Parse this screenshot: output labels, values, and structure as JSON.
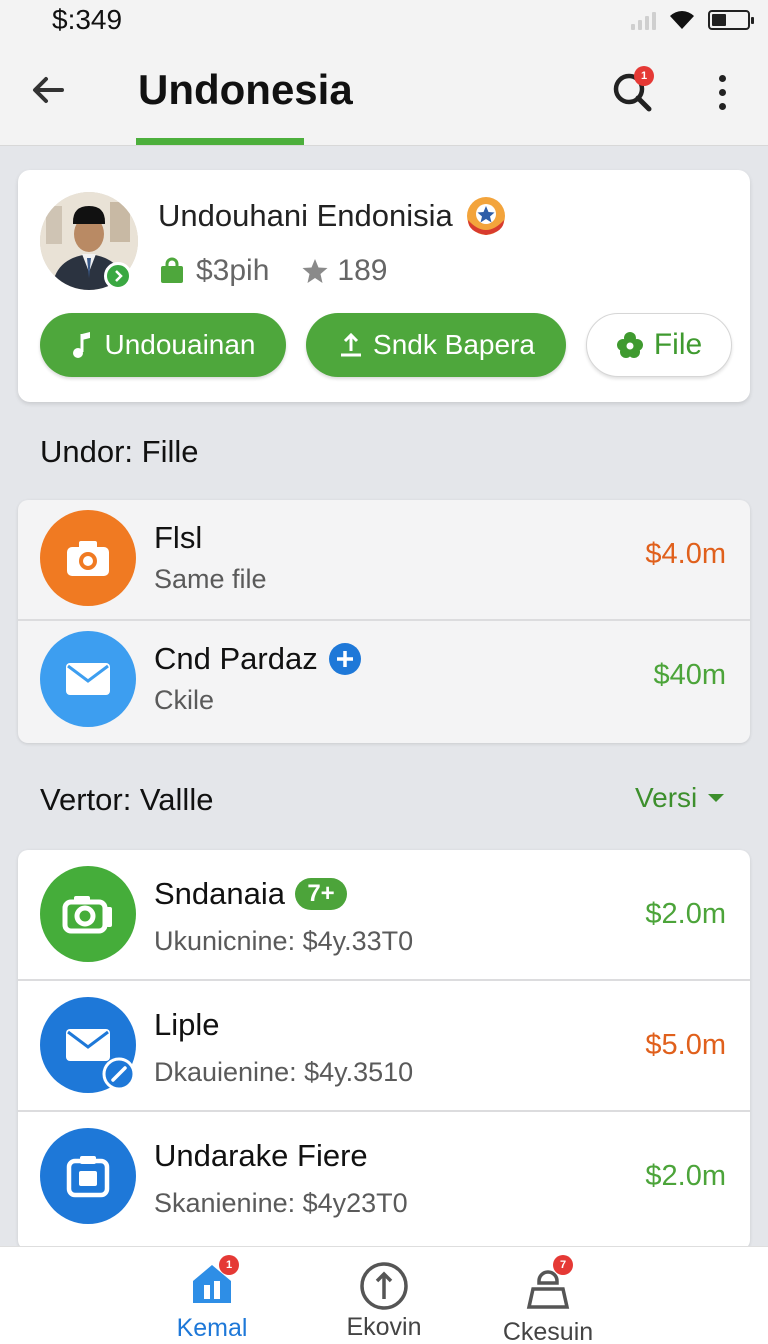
{
  "status_bar": {
    "time": "$:349"
  },
  "app_bar": {
    "title": "Undonesia",
    "search_badge": "1"
  },
  "profile": {
    "name": "Undouhani Endonisia",
    "price": "$3pih",
    "rating": "189",
    "buttons": [
      {
        "label": "Undouainan"
      },
      {
        "label": "Sndk Bapera"
      },
      {
        "label": "File"
      }
    ]
  },
  "section1": {
    "title": "Undor: Fille",
    "items": [
      {
        "title": "Flsl",
        "subtitle": "Same file",
        "price": "$4.0m",
        "price_color": "#e0601c",
        "icon": "camera-icon",
        "icon_color": "#f07a22"
      },
      {
        "title": "Cnd Pardaz",
        "subtitle": "Ckile",
        "price": "$40m",
        "price_color": "#4ca43a",
        "icon": "mail-icon",
        "icon_color": "#3d9ef0"
      }
    ]
  },
  "section2": {
    "title": "Vertor: Vallle",
    "action": "Versi",
    "items": [
      {
        "title": "Sndanaia",
        "badge": "7+",
        "subtitle": "Ukunicnine: $4y.33T0",
        "price": "$2.0m",
        "price_color": "#4ca43a",
        "icon": "camera-icon",
        "icon_color": "#45ad3a"
      },
      {
        "title": "Liple",
        "subtitle": "Dkauienine: $4y.3510",
        "price": "$5.0m",
        "price_color": "#e0601c",
        "icon": "mail-icon",
        "icon_color": "#1e78d8"
      },
      {
        "title": "Undarake Fiere",
        "subtitle": "Skanienine: $4y23T0",
        "price": "$2.0m",
        "price_color": "#4ca43a",
        "icon": "photo-icon",
        "icon_color": "#1e78d8"
      }
    ]
  },
  "bottom_nav": [
    {
      "label": "Kemal",
      "badge": "1",
      "active": true
    },
    {
      "label": "Ekovin"
    },
    {
      "label": "Ckesuin",
      "badge": "7"
    }
  ],
  "colors": {
    "accent_green": "#4ea73c",
    "brand_blue": "#1e78d8",
    "orange": "#f07a22"
  }
}
